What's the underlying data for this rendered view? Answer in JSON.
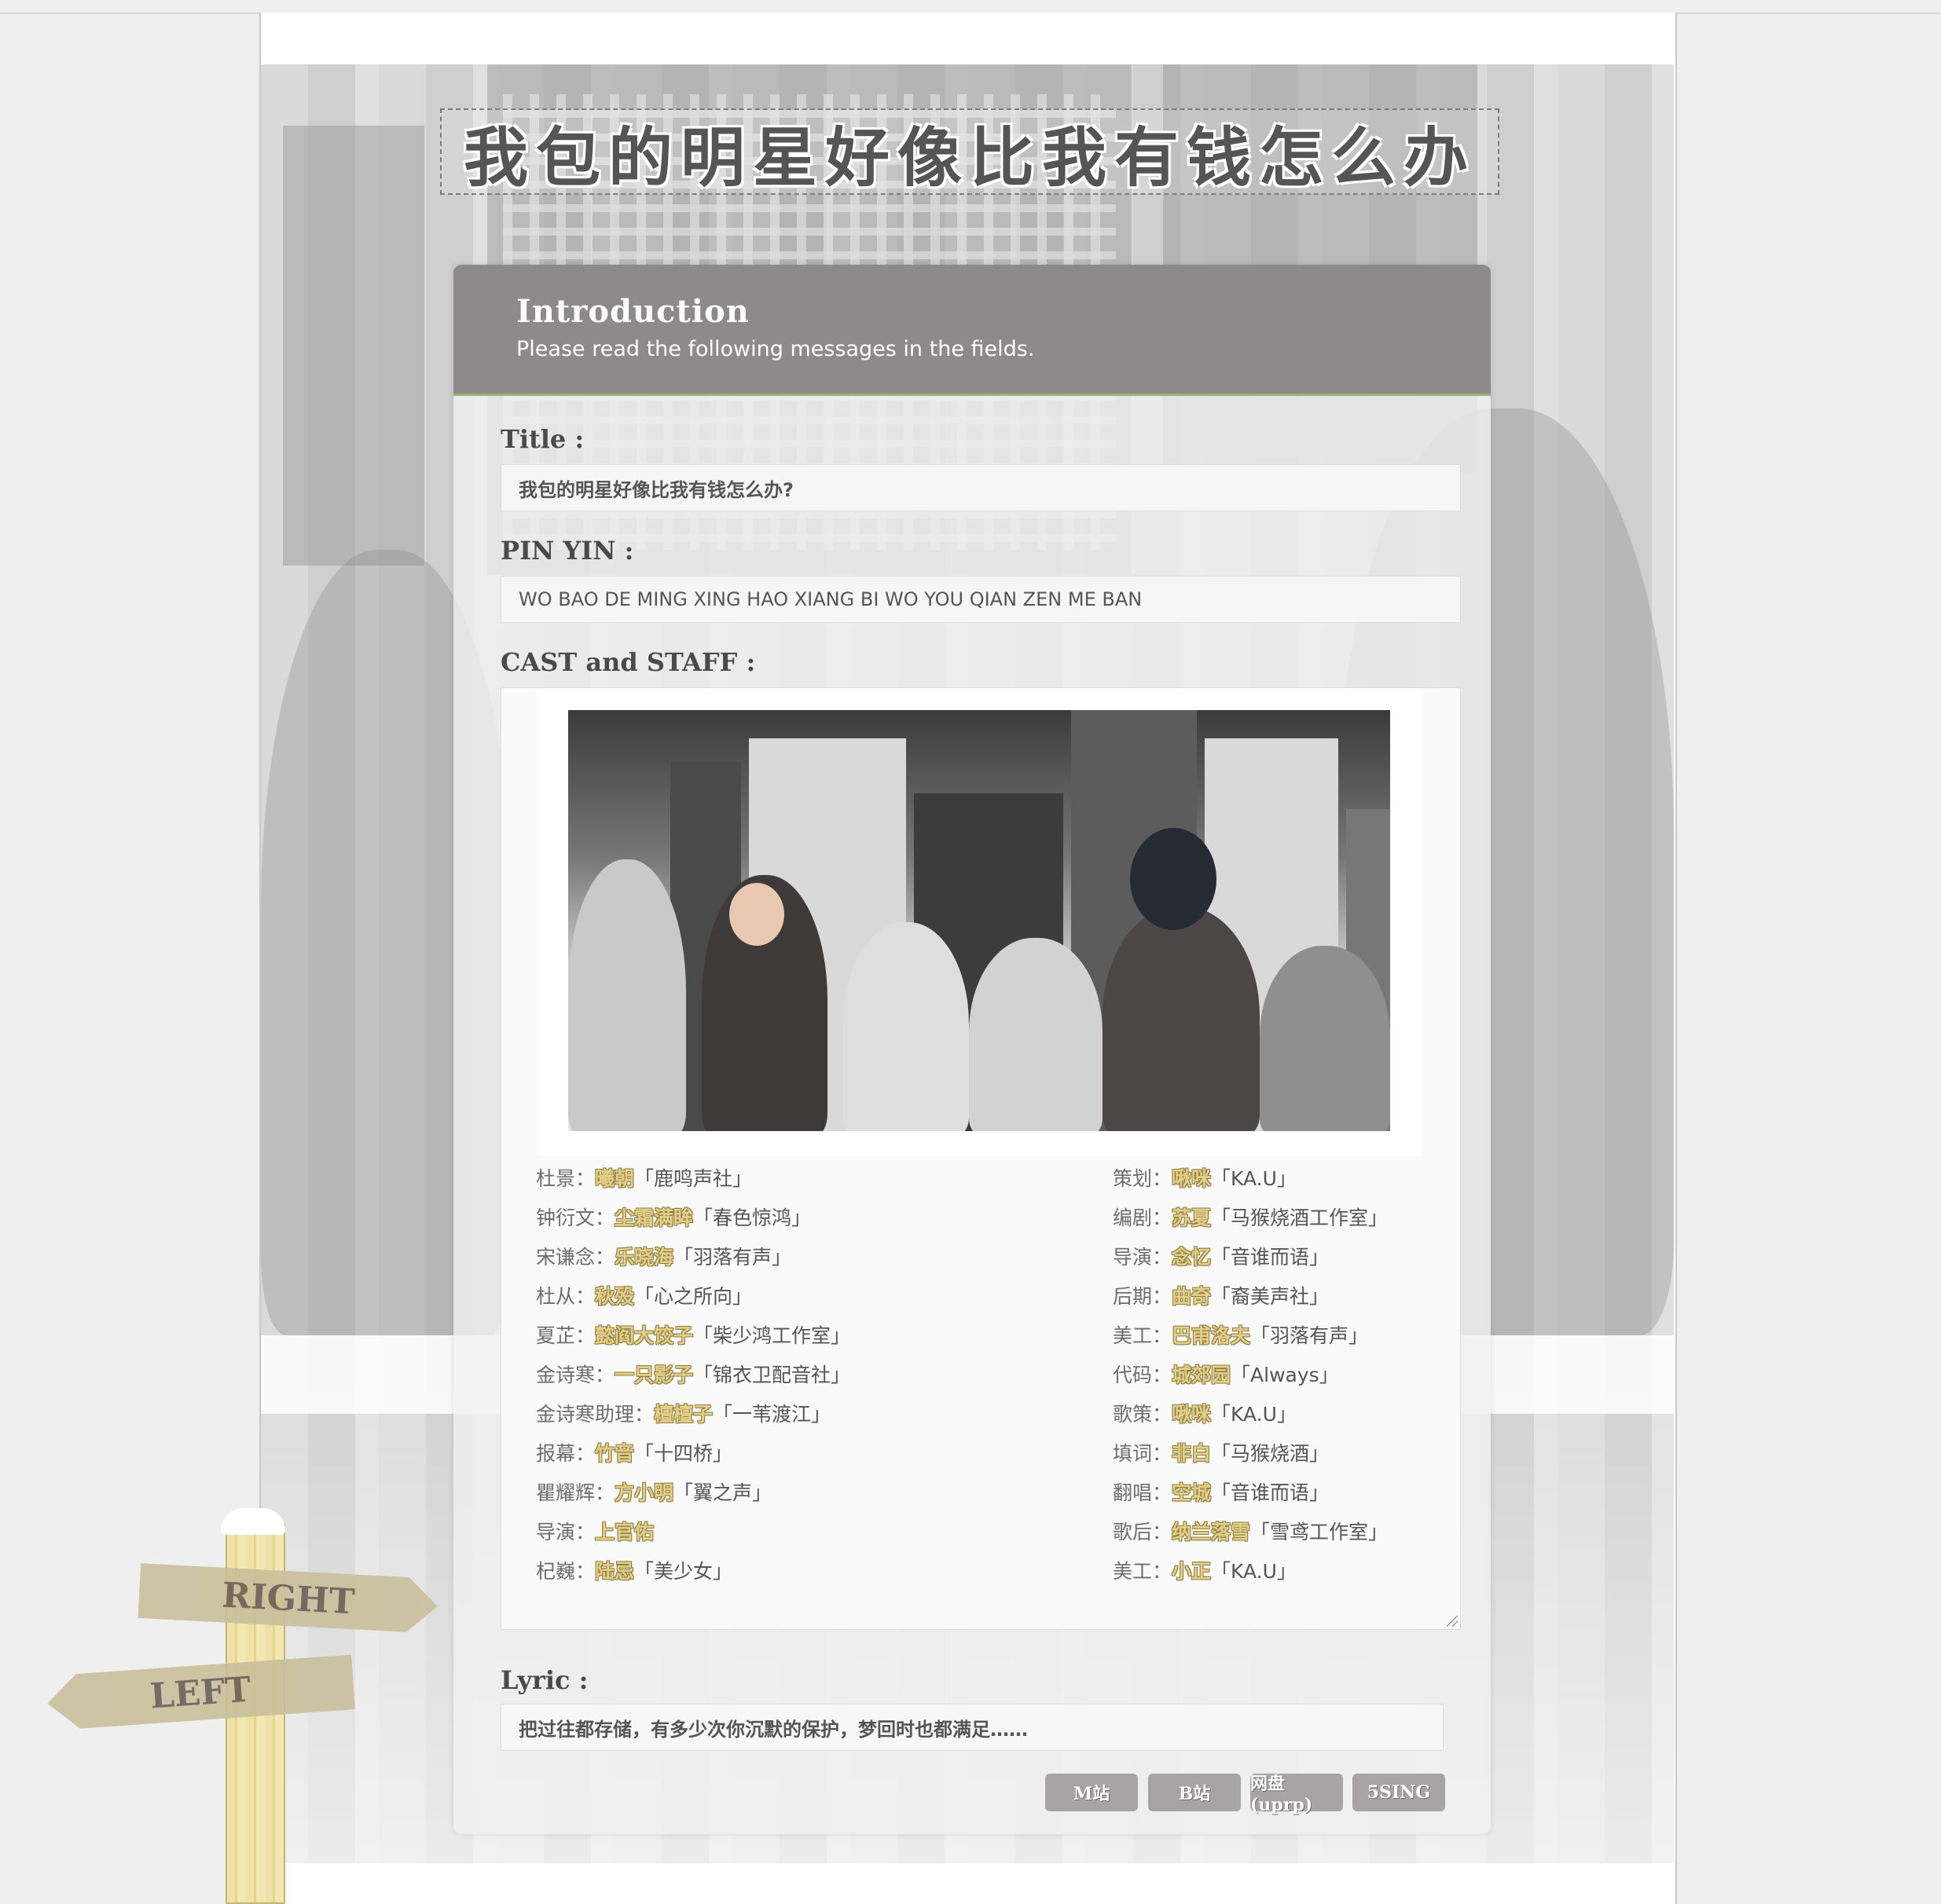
{
  "header": {
    "title": "我包的明星好像比我有钱怎么办"
  },
  "panel": {
    "intro_title": "Introduction",
    "intro_subtitle": "Please read the following messages in the fields."
  },
  "fields": {
    "title_label": "Title :",
    "title_value": "我包的明星好像比我有钱怎么办?",
    "pinyin_label": "PIN YIN :",
    "pinyin_value": "WO BAO DE MING XING HAO XIANG BI WO YOU QIAN ZEN ME BAN",
    "cast_label": "CAST and STAFF :",
    "lyric_label": "Lyric :",
    "lyric_value": "把过往都存储，有多少次你沉默的保护，梦回时也都满足……"
  },
  "cast": [
    {
      "role": "杜景：",
      "name": "曦朝",
      "group": "「鹿鸣声社」"
    },
    {
      "role": "钟衍文：",
      "name": "尘霜满眸",
      "group": "「春色惊鸿」"
    },
    {
      "role": "宋谦念：",
      "name": "乐晓海",
      "group": "「羽落有声」"
    },
    {
      "role": "杜从：",
      "name": "秋殁",
      "group": "「心之所向」"
    },
    {
      "role": "夏芷：",
      "name": "懿阎大饺子",
      "group": "「柴少鸿工作室」"
    },
    {
      "role": "金诗寒：",
      "name": "一只影子",
      "group": "「锦衣卫配音社」"
    },
    {
      "role": "金诗寒助理：",
      "name": "檀檀子",
      "group": "「一苇渡江」"
    },
    {
      "role": "报幕：",
      "name": "竹音",
      "group": "「十四桥」"
    },
    {
      "role": "瞿耀辉：",
      "name": "方小明",
      "group": "「翼之声」"
    },
    {
      "role": "导演：",
      "name": "上官佑",
      "group": ""
    },
    {
      "role": "杞巍：",
      "name": "陆忌",
      "group": "「美少女」"
    }
  ],
  "staff": [
    {
      "role": "策划：",
      "name": "啾咪",
      "group": "「KA.U」"
    },
    {
      "role": "编剧：",
      "name": "苏夏",
      "group": "「马猴烧酒工作室」"
    },
    {
      "role": "导演：",
      "name": "念忆",
      "group": "「音谁而语」"
    },
    {
      "role": "后期：",
      "name": "曲奇",
      "group": "「裔美声社」"
    },
    {
      "role": "美工：",
      "name": "巴甫洛夫",
      "group": "「羽落有声」"
    },
    {
      "role": "代码：",
      "name": "城郊园",
      "group": "「Always」"
    },
    {
      "role": "歌策：",
      "name": "啾咪",
      "group": "「KA.U」"
    },
    {
      "role": "填词：",
      "name": "非白",
      "group": "「马猴烧酒」"
    },
    {
      "role": "翻唱：",
      "name": "空城",
      "group": "「音谁而语」"
    },
    {
      "role": "歌后：",
      "name": "纳兰落雪",
      "group": "「雪鸢工作室」"
    },
    {
      "role": "美工：",
      "name": "小正",
      "group": "「KA.U」"
    }
  ],
  "buttons": {
    "m_site": "M站",
    "b_site": "B站",
    "netdisk": "网盘(uprp)",
    "sing": "5SING"
  },
  "signpost": {
    "right": "RIGHT",
    "left": "LEFT"
  },
  "colors": {
    "header_bg": "#8d8a8c",
    "accent_line": "#9ab36d",
    "name_highlight": "#e4cf86",
    "button_bg": "#a7a4a6"
  }
}
